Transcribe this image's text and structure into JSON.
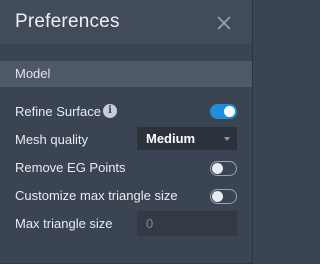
{
  "header": {
    "title": "Preferences",
    "close_icon": "close-icon"
  },
  "section": {
    "label": "Model"
  },
  "rows": {
    "refine_surface": {
      "label": "Refine Surface",
      "info_icon": "info-icon",
      "info_glyph": "i",
      "toggle_on": true
    },
    "mesh_quality": {
      "label": "Mesh quality",
      "value": "Medium"
    },
    "remove_eg_points": {
      "label": "Remove EG Points",
      "toggle_on": false
    },
    "customize_max": {
      "label": "Customize max triangle size",
      "toggle_on": false
    },
    "max_triangle_size": {
      "label": "Max triangle size",
      "value": "0"
    }
  },
  "colors": {
    "accent": "#1f8fdb",
    "panel": "#3b4452",
    "header": "#424b59",
    "section": "#4e5868"
  }
}
